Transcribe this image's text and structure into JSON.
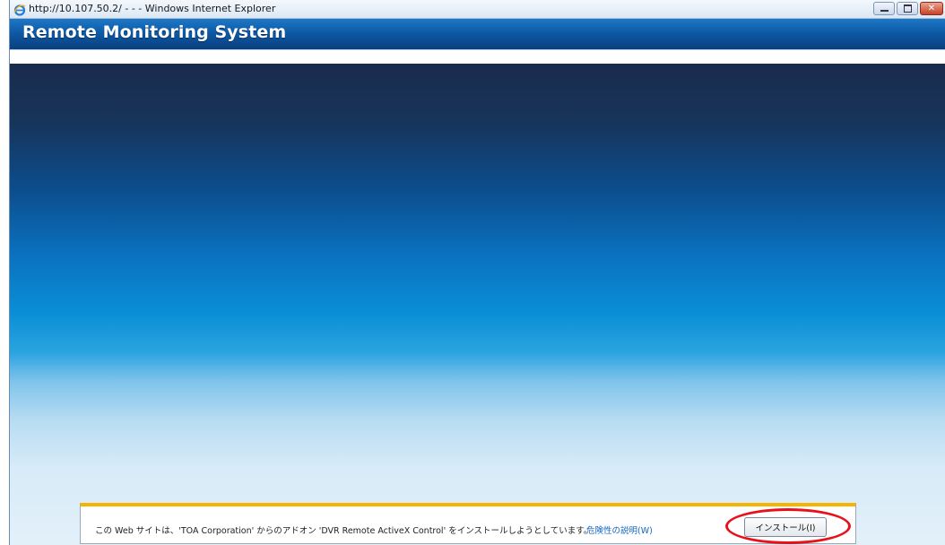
{
  "window": {
    "title": "http://10.107.50.2/ - - - Windows Internet Explorer",
    "controls": {
      "minimize_icon": "minimize-icon",
      "maximize_icon": "maximize-icon",
      "close_icon": "close-icon",
      "close_glyph": "✕"
    }
  },
  "app": {
    "title": "Remote Monitoring System"
  },
  "infobar": {
    "message": "この Web サイトは、'TOA Corporation' からのアドオン 'DVR Remote ActiveX Control' をインストールしようとしています。",
    "risk_link": "危険性の説明(W)",
    "install_button": "インストール(I)"
  },
  "colors": {
    "highlight": "#e8111a",
    "infobar_accent": "#f4b400",
    "appbar": "#0d5aa6"
  }
}
